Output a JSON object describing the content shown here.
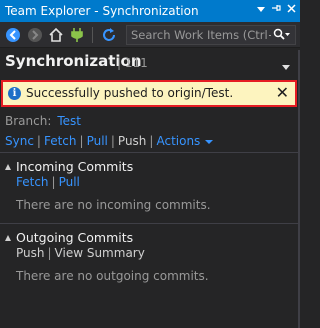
{
  "window": {
    "title": "Team Explorer - Synchronization"
  },
  "toolbar": {
    "search_placeholder": "Search Work Items (Ctrl+"
  },
  "header": {
    "title": "Synchronization",
    "separator": "|",
    "count": "111"
  },
  "notification": {
    "message": "Successfully pushed to origin/Test."
  },
  "branch": {
    "label": "Branch:",
    "name": "Test"
  },
  "actions": {
    "sync": "Sync",
    "fetch": "Fetch",
    "pull": "Pull",
    "push": "Push",
    "actions": "Actions"
  },
  "incoming": {
    "title": "Incoming Commits",
    "fetch": "Fetch",
    "pull": "Pull",
    "empty": "There are no incoming commits."
  },
  "outgoing": {
    "title": "Outgoing Commits",
    "push": "Push",
    "view_summary": "View Summary",
    "empty": "There are no outgoing commits."
  },
  "colors": {
    "accent": "#007acc",
    "link": "#3794ff",
    "notify_bg": "#fdf4bf",
    "notify_border": "#e51c23"
  }
}
